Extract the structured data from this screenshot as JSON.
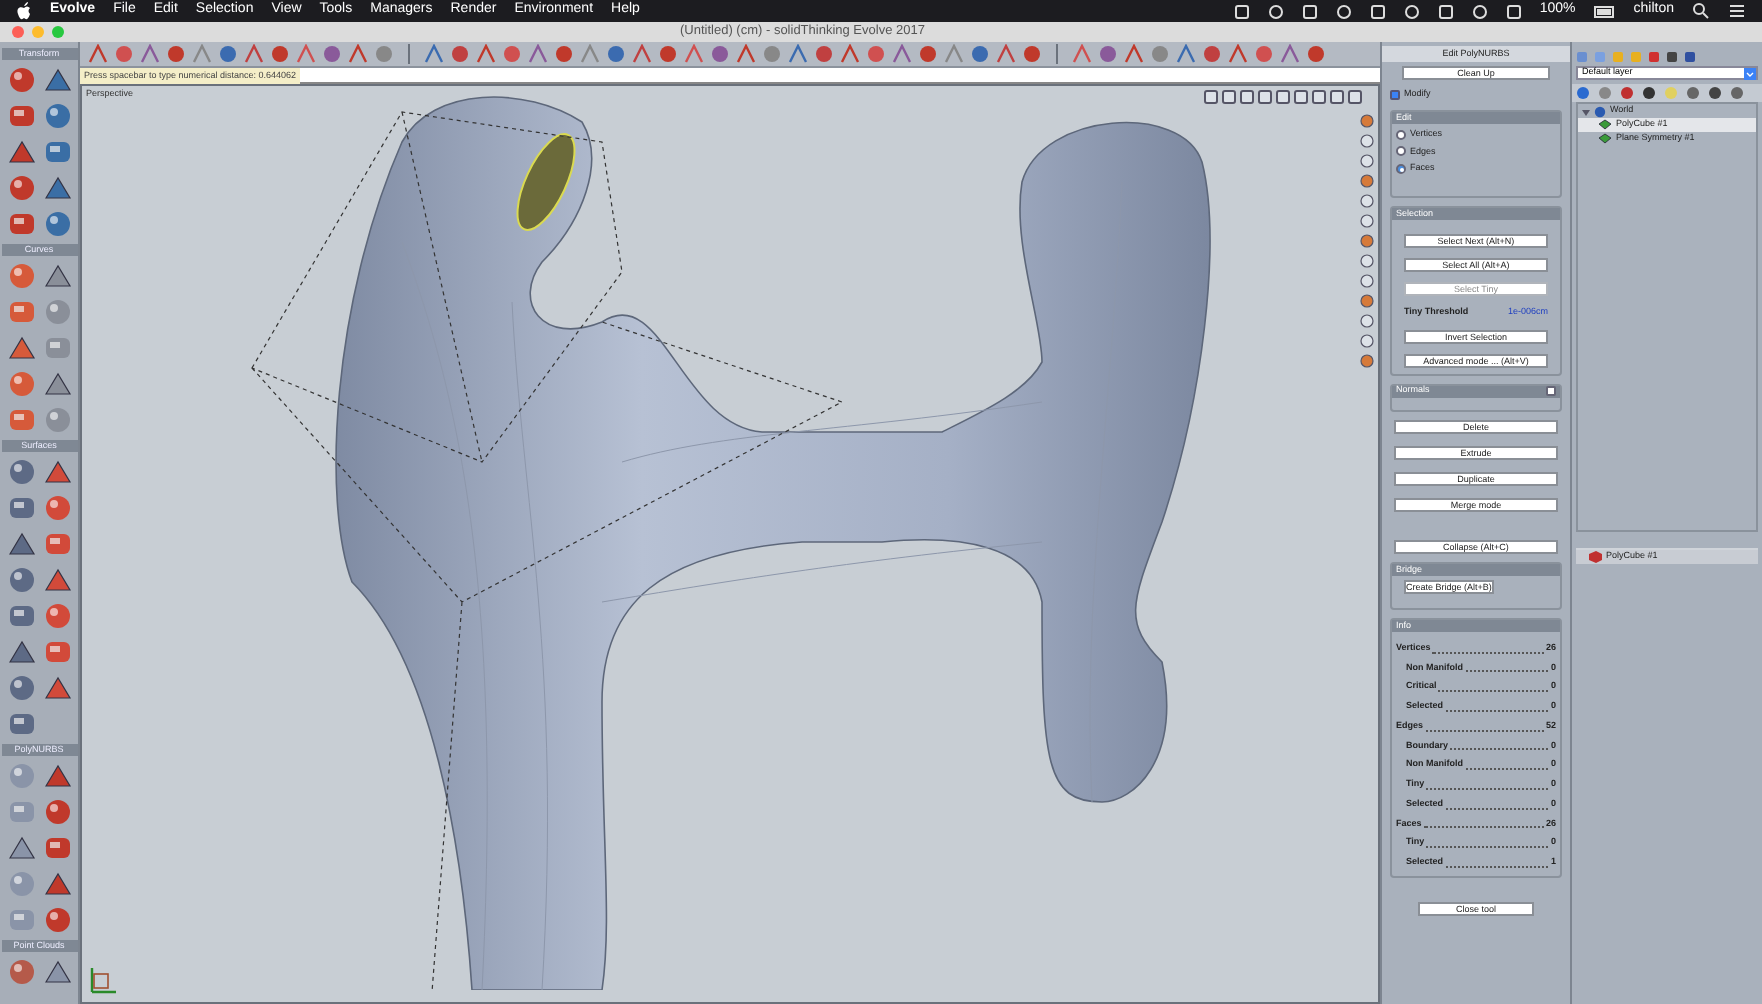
{
  "menubar": {
    "app": "Evolve",
    "menus": [
      "File",
      "Edit",
      "Selection",
      "View",
      "Tools",
      "Managers",
      "Render",
      "Environment",
      "Help"
    ],
    "status": [
      "100%",
      "chilton"
    ]
  },
  "window": {
    "title": "(Untitled) (cm) - solidThinking Evolve 2017"
  },
  "prompt": {
    "text": "Press spacebar to type numerical distance: 0.644062"
  },
  "left_toolbar": {
    "sections": [
      "Transform",
      "Curves",
      "Surfaces",
      "PolyNURBS",
      "Point Clouds"
    ]
  },
  "viewport": {
    "label": "Perspective"
  },
  "edit_panel": {
    "title": "Edit PolyNURBS",
    "clean_up": "Clean Up",
    "modify": {
      "label": "Modify",
      "checked": true
    },
    "edit_group": {
      "title": "Edit",
      "options": [
        {
          "label": "Vertices",
          "selected": false
        },
        {
          "label": "Edges",
          "selected": false
        },
        {
          "label": "Faces",
          "selected": true
        }
      ]
    },
    "selection_group": {
      "title": "Selection",
      "items": [
        {
          "kind": "button",
          "label": "Select Next (Alt+N)",
          "disabled": false
        },
        {
          "kind": "button",
          "label": "Select All (Alt+A)",
          "disabled": false
        },
        {
          "kind": "button",
          "label": "Select Tiny",
          "disabled": true
        },
        {
          "kind": "threshold",
          "label": "Tiny Threshold",
          "value": "1e-006cm"
        },
        {
          "kind": "button",
          "label": "Invert Selection",
          "disabled": false
        },
        {
          "kind": "button",
          "label": "Advanced mode ... (Alt+V)",
          "disabled": false
        }
      ]
    },
    "normals": {
      "title": "Normals",
      "checked": false
    },
    "actions": [
      "Delete",
      "Extrude",
      "Duplicate",
      "Merge mode"
    ],
    "collapse": "Collapse (Alt+C)",
    "bridge": {
      "title": "Bridge",
      "button": "Create Bridge (Alt+B)"
    },
    "info": {
      "title": "Info",
      "rows": [
        {
          "label": "Vertices",
          "value": "26",
          "children": [
            {
              "label": "Non Manifold",
              "value": "0"
            },
            {
              "label": "Critical",
              "value": "0"
            },
            {
              "label": "Selected",
              "value": "0"
            }
          ]
        },
        {
          "label": "Edges",
          "value": "52",
          "children": [
            {
              "label": "Boundary",
              "value": "0"
            },
            {
              "label": "Non Manifold",
              "value": "0"
            },
            {
              "label": "Tiny",
              "value": "0"
            },
            {
              "label": "Selected",
              "value": "0"
            }
          ]
        },
        {
          "label": "Faces",
          "value": "26",
          "children": [
            {
              "label": "Tiny",
              "value": "0"
            },
            {
              "label": "Selected",
              "value": "1"
            }
          ]
        }
      ]
    },
    "close_tool": "Close tool"
  },
  "browser": {
    "layer": "Default layer",
    "tree": [
      {
        "label": "World",
        "expanded": true,
        "selected": false,
        "children": [
          {
            "label": "PolyCube #1",
            "selected": true
          },
          {
            "label": "Plane Symmetry #1",
            "selected": false
          }
        ]
      }
    ],
    "bottom_list": [
      "PolyCube #1"
    ]
  }
}
